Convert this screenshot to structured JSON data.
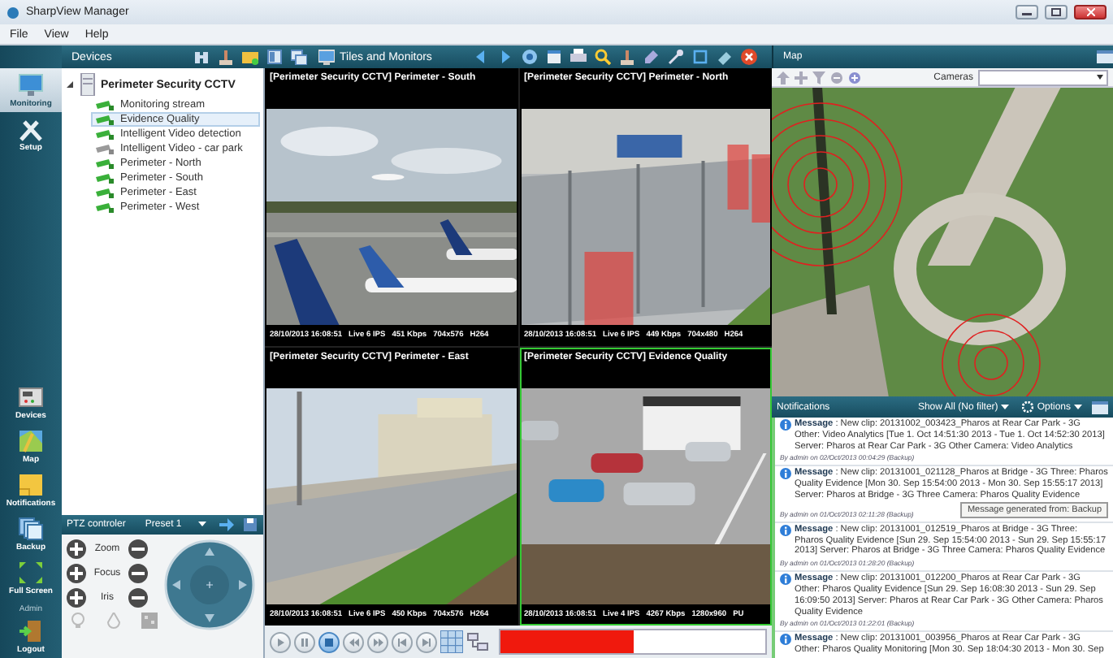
{
  "window": {
    "title": "SharpView Manager"
  },
  "menu": [
    "File",
    "View",
    "Help"
  ],
  "rail": {
    "top": [
      {
        "label": "Monitoring",
        "kind": "monitor",
        "selected": true
      },
      {
        "label": "Setup",
        "kind": "tools",
        "selected": false
      }
    ],
    "bottom": [
      {
        "label": "Devices",
        "kind": "devices"
      },
      {
        "label": "Map",
        "kind": "map"
      },
      {
        "label": "Notifications",
        "kind": "note"
      },
      {
        "label": "Backup",
        "kind": "backup"
      },
      {
        "label": "Full Screen",
        "kind": "fullscreen"
      },
      {
        "label": "Admin",
        "kind": "caption"
      },
      {
        "label": "Logout",
        "kind": "logout"
      }
    ]
  },
  "toolbar": {
    "devices_label": "Devices",
    "tiles_button": "Tiles and Monitors"
  },
  "tree": {
    "root": "Perimeter Security CCTV",
    "expanded": true,
    "children": [
      {
        "label": "Monitoring stream",
        "selected": false,
        "online": true
      },
      {
        "label": "Evidence Quality",
        "selected": true,
        "online": true
      },
      {
        "label": "Intelligent Video detection",
        "selected": false,
        "online": true
      },
      {
        "label": "Intelligent Video - car park",
        "selected": false,
        "online": false
      },
      {
        "label": "Perimeter - North",
        "selected": false,
        "online": true
      },
      {
        "label": "Perimeter - South",
        "selected": false,
        "online": true
      },
      {
        "label": "Perimeter - East",
        "selected": false,
        "online": true
      },
      {
        "label": "Perimeter - West",
        "selected": false,
        "online": true
      }
    ]
  },
  "ptz": {
    "title": "PTZ controler",
    "preset": "Preset 1",
    "controls": [
      "Zoom",
      "Focus",
      "Iris"
    ]
  },
  "tiles": [
    {
      "title": "[Perimeter Security CCTV] Perimeter - South",
      "stats": [
        "28/10/2013 16:08:51",
        "Live 6 IPS",
        "451 Kbps",
        "704x576",
        "H264"
      ],
      "selected": false
    },
    {
      "title": "[Perimeter Security CCTV] Perimeter - North",
      "stats": [
        "28/10/2013 16:08:51",
        "Live 6 IPS",
        "449 Kbps",
        "704x480",
        "H264"
      ],
      "selected": false
    },
    {
      "title": "[Perimeter Security CCTV] Perimeter - East",
      "stats": [
        "28/10/2013 16:08:51",
        "Live 6 IPS",
        "450 Kbps",
        "704x576",
        "H264"
      ],
      "selected": false
    },
    {
      "title": "[Perimeter Security CCTV] Evidence Quality",
      "stats": [
        "28/10/2013 16:08:51",
        "Live 4 IPS",
        "4267 Kbps",
        "1280x960",
        "PU"
      ],
      "selected": true
    }
  ],
  "timeline": {
    "level": 0.5
  },
  "map": {
    "title": "Map",
    "cameras_label": "Cameras"
  },
  "notifications": {
    "title": "Notifications",
    "filter": "Show All (No filter)",
    "options": "Options",
    "messages": [
      {
        "text": "**Message** : New clip: 20131002_003423_Pharos at Rear Car Park - 3G Other: Video Analytics [Tue 1. Oct 14:51:30 2013 - Tue 1. Oct 14:52:30 2013] Server: Pharos at Rear Car Park - 3G Other Camera: Video Analytics",
        "meta": "By admin on 02/Oct/2013 00:04:29 (Backup)"
      },
      {
        "text": "**Message** : New clip: 20131001_021128_Pharos at Bridge - 3G Three: Pharos Quality Evidence [Mon 30. Sep 15:54:00 2013 - Mon 30. Sep 15:55:17 2013] Server: Pharos at Bridge - 3G Three Camera: Pharos Quality Evidence",
        "meta": "By admin on 01/Oct/2013 02:11:28 (Backup)",
        "tooltip": "Message generated from: Backup"
      },
      {
        "text": "**Message** : New clip: 20131001_012519_Pharos at Bridge - 3G Three: Pharos Quality Evidence [Sun 29. Sep 15:54:00 2013 - Sun 29. Sep 15:55:17 2013] Server: Pharos at Bridge - 3G Three Camera: Pharos Quality Evidence",
        "meta": "By admin on 01/Oct/2013 01:28:20 (Backup)"
      },
      {
        "text": "**Message** : New clip: 20131001_012200_Pharos at Rear Car Park - 3G Other: Pharos Quality Evidence [Sun 29. Sep 16:08:30 2013 - Sun 29. Sep 16:09:50 2013] Server: Pharos at Rear Car Park - 3G Other Camera: Pharos Quality Evidence",
        "meta": "By admin on 01/Oct/2013 01:22:01 (Backup)"
      },
      {
        "text": "**Message** : New clip: 20131001_003956_Pharos at Rear Car Park - 3G Other: Pharos Quality Monitoring [Mon 30. Sep 18:04:30 2013 - Mon 30. Sep"
      }
    ]
  }
}
